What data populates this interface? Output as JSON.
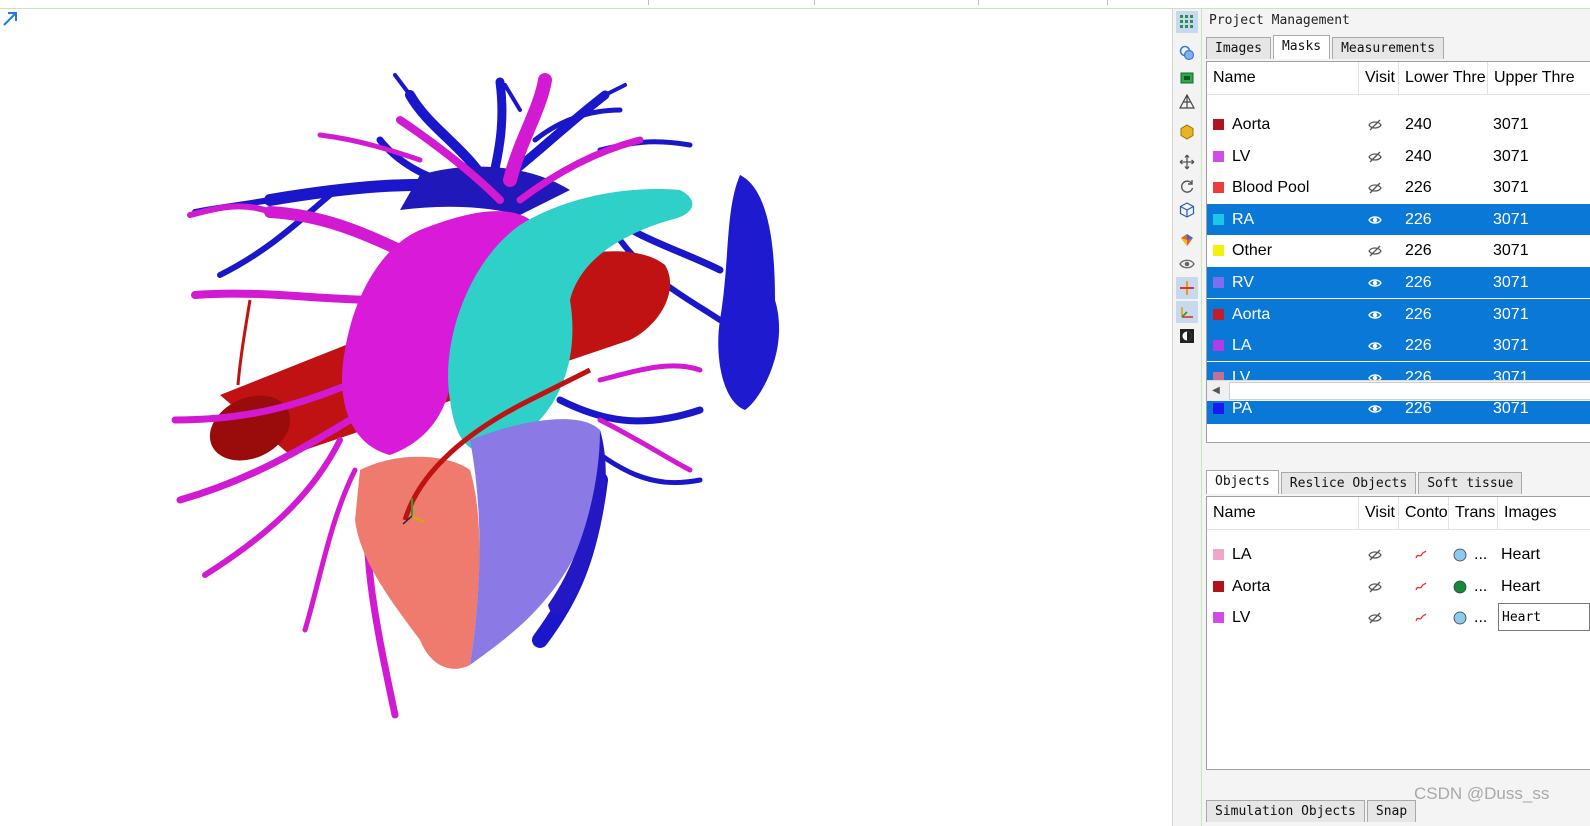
{
  "project_panel": {
    "title": "Project Management",
    "tabs": [
      "Images",
      "Masks",
      "Measurements"
    ],
    "selected_tab": "Masks"
  },
  "masks_table": {
    "columns": [
      "Name",
      "Visit",
      "Lower Thre",
      "Upper Thre"
    ],
    "rows": [
      {
        "name": "Aorta",
        "color": "#b0131a",
        "visible": false,
        "lower": "240",
        "upper": "3071",
        "selected": false
      },
      {
        "name": "LV",
        "color": "#d24ce6",
        "visible": false,
        "lower": "240",
        "upper": "3071",
        "selected": false
      },
      {
        "name": "Blood Pool",
        "color": "#ee3b3b",
        "visible": false,
        "lower": "226",
        "upper": "3071",
        "selected": false
      },
      {
        "name": "RA",
        "color": "#19c8e8",
        "visible": true,
        "lower": "226",
        "upper": "3071",
        "selected": true
      },
      {
        "name": "Other",
        "color": "#f3f00a",
        "visible": false,
        "lower": "226",
        "upper": "3071",
        "selected": false
      },
      {
        "name": "RV",
        "color": "#7a6ff0",
        "visible": true,
        "lower": "226",
        "upper": "3071",
        "selected": true
      },
      {
        "name": "Aorta",
        "color": "#c21d2c",
        "visible": true,
        "lower": "226",
        "upper": "3071",
        "selected": true
      },
      {
        "name": "LA",
        "color": "#b23be6",
        "visible": true,
        "lower": "226",
        "upper": "3071",
        "selected": true
      },
      {
        "name": "LV",
        "color": "#c0709a",
        "visible": true,
        "lower": "226",
        "upper": "3071",
        "selected": true
      },
      {
        "name": "PA",
        "color": "#1a1aee",
        "visible": true,
        "lower": "226",
        "upper": "3071",
        "selected": true
      }
    ]
  },
  "objects_panel": {
    "tabs": [
      "Objects",
      "Reslice Objects",
      "Soft tissue"
    ],
    "selected_tab": "Objects"
  },
  "objects_table": {
    "columns": [
      "Name",
      "Visit",
      "Conto",
      "Trans",
      "Images"
    ],
    "rows": [
      {
        "name": "LA",
        "color": "#f0a6c8",
        "trans_color": "#8ec9f0",
        "trans_text": "...",
        "image": "Heart"
      },
      {
        "name": "Aorta",
        "color": "#b0131a",
        "trans_color": "#178a3a",
        "trans_text": "...",
        "image": "Heart"
      },
      {
        "name": "LV",
        "color": "#d24ce6",
        "trans_color": "#8ec9f0",
        "trans_text": "...",
        "image": "Heart"
      }
    ]
  },
  "bottom_tabs": [
    "Simulation Objects",
    "Snap"
  ],
  "watermark": "CSDN @Duss_ss",
  "toolbar_icons": [
    "grid-icon",
    "color-picker-icon",
    "mask-icon",
    "triangle-mesh-icon",
    "shape-icon",
    "move-icon",
    "rotate-icon",
    "cube-icon",
    "render-icon",
    "eye-icon",
    "crosshair-icon",
    "axis-icon",
    "contrast-icon"
  ]
}
